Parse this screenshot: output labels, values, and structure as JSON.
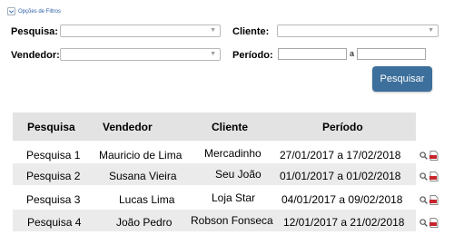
{
  "filter_toggle": {
    "label": "Opções de Filtros"
  },
  "filters": {
    "pesquisa_label": "Pesquisa:",
    "cliente_label": "Cliente:",
    "vendedor_label": "Vendedor:",
    "periodo_label": "Período:",
    "periodo_separator": "a",
    "submit_label": "Pesquisar"
  },
  "table": {
    "headers": [
      "Pesquisa",
      "Vendedor",
      "Cliente",
      "Período"
    ],
    "rows": [
      {
        "pesquisa": "Pesquisa 1",
        "vendedor": "Mauricio de Lima",
        "cliente": "Mercadinho",
        "periodo": "27/01/2017 a 17/02/2018"
      },
      {
        "pesquisa": "Pesquisa 2",
        "vendedor": "Susana Vieira",
        "cliente": "Seu João",
        "periodo": "01/01/2017 a 01/02/2018"
      },
      {
        "pesquisa": "Pesquisa 3",
        "vendedor": "Lucas Lima",
        "cliente": "Loja Star",
        "periodo": "04/01/2017 a 09/02/2018"
      },
      {
        "pesquisa": "Pesquisa 4",
        "vendedor": "João Pedro",
        "cliente": "Robson Fonseca",
        "periodo": "12/01/2017 a 21/02/2018"
      }
    ]
  },
  "icons": {
    "view": "magnifier-icon",
    "pdf": "pdf-icon",
    "accent": "#3c6f9b",
    "pdf_red": "#c8242b"
  }
}
